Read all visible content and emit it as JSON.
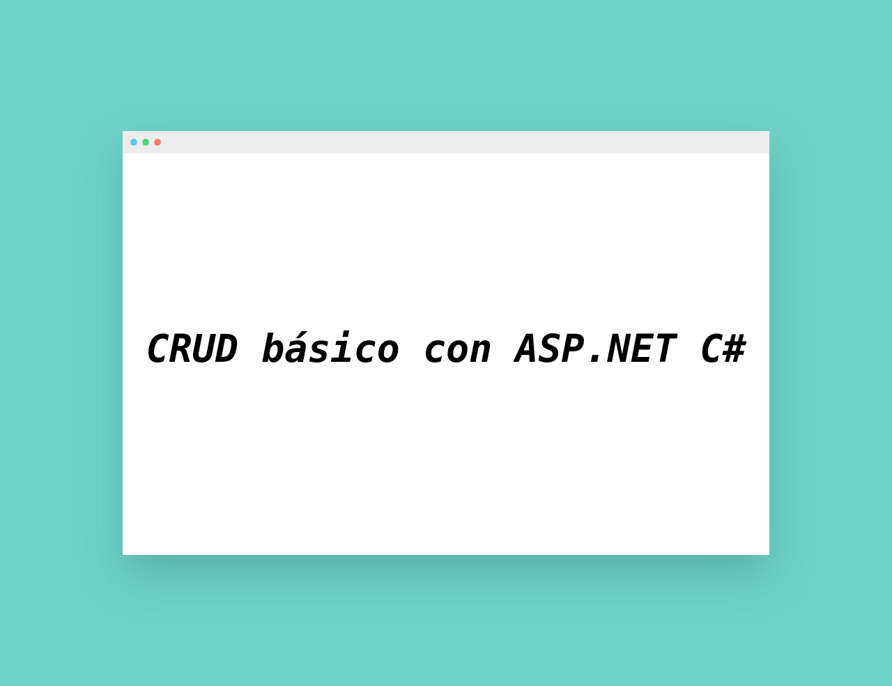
{
  "window": {
    "controls": [
      {
        "name": "window-dot-blue-icon",
        "color": "#5ac8e8"
      },
      {
        "name": "window-dot-green-icon",
        "color": "#4cd97e"
      },
      {
        "name": "window-dot-red-icon",
        "color": "#ff7b6b"
      }
    ]
  },
  "main": {
    "headline": "CRUD básico con ASP.NET C#"
  },
  "colors": {
    "background": "#70d3c7",
    "window": "#ffffff",
    "title_bar": "#ededed",
    "text": "#000000"
  }
}
